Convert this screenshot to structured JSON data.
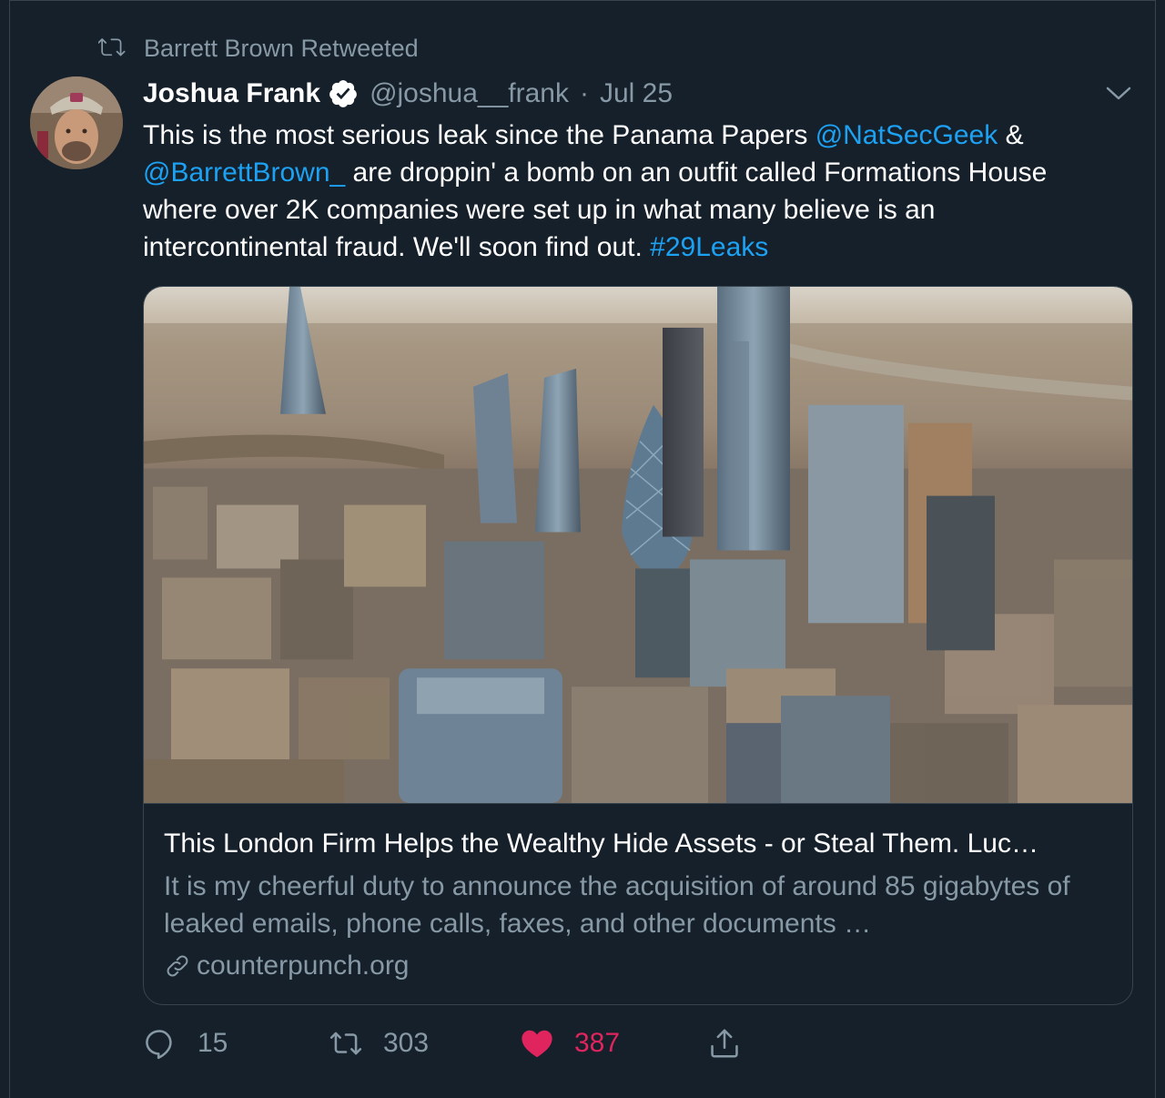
{
  "retweet_context": {
    "icon": "retweet-icon",
    "text": "Barrett Brown Retweeted"
  },
  "tweet": {
    "author_name": "Joshua Frank",
    "verified_icon": "verified-badge-icon",
    "handle": "@joshua__frank",
    "separator": "·",
    "date": "Jul 25",
    "text_parts": {
      "p1": "This is the most serious leak since the Panama Papers ",
      "mention1": "@NatSecGeek",
      "p2": " & ",
      "mention2": "@BarrettBrown_",
      "p3": " are droppin' a bomb on an outfit called Formations House where over 2K companies were set up in what many believe is an intercontinental fraud. We'll soon find out. ",
      "hashtag": "#29Leaks"
    }
  },
  "card": {
    "title": "This London Firm Helps the Wealthy Hide Assets - or Steal Them. Luc…",
    "description": "It is my cheerful duty to announce the acquisition of around 85 gigabytes of leaked emails, phone calls, faxes, and other documents …",
    "domain": "counterpunch.org",
    "link_icon": "link-icon"
  },
  "actions": {
    "reply_count": "15",
    "retweet_count": "303",
    "like_count": "387",
    "like_color": "#e0245e"
  },
  "colors": {
    "background": "#15202b",
    "secondary_text": "#8899a6",
    "link": "#1da1f2",
    "border": "#38444d"
  }
}
